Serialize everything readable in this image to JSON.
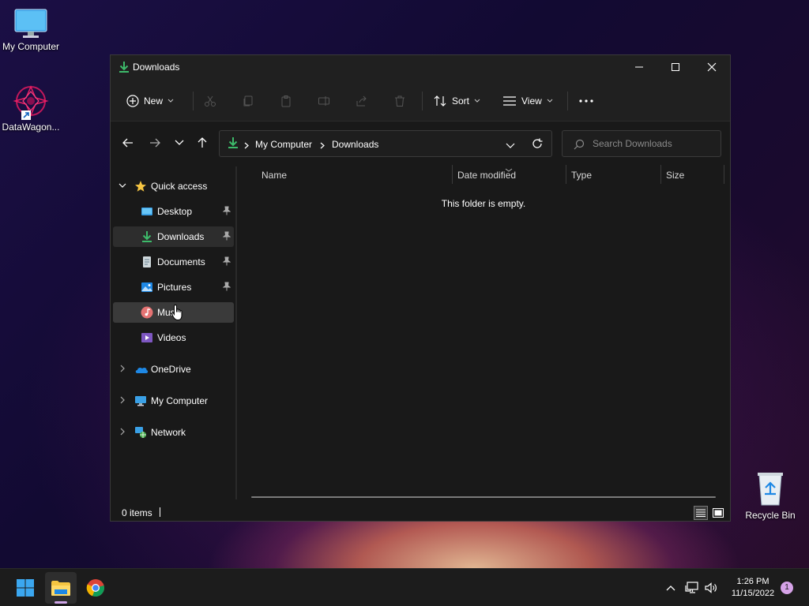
{
  "desktop": {
    "icons": [
      {
        "label": "My Computer"
      },
      {
        "label": "DataWagon..."
      },
      {
        "label": "Recycle Bin"
      }
    ]
  },
  "window": {
    "title": "Downloads",
    "toolbar": {
      "new_label": "New",
      "sort_label": "Sort",
      "view_label": "View"
    },
    "address": {
      "crumbs": [
        "My Computer",
        "Downloads"
      ]
    },
    "search": {
      "placeholder": "Search Downloads"
    },
    "sidebar": {
      "quick_access": "Quick access",
      "items": [
        {
          "label": "Desktop"
        },
        {
          "label": "Downloads"
        },
        {
          "label": "Documents"
        },
        {
          "label": "Pictures"
        },
        {
          "label": "Music"
        },
        {
          "label": "Videos"
        }
      ],
      "sections": [
        {
          "label": "OneDrive"
        },
        {
          "label": "My Computer"
        },
        {
          "label": "Network"
        }
      ]
    },
    "columns": [
      "Name",
      "Date modified",
      "Type",
      "Size"
    ],
    "empty_message": "This folder is empty.",
    "status": {
      "count": "0 items"
    }
  },
  "taskbar": {
    "time": "1:26 PM",
    "date": "11/15/2022",
    "notification_count": "1"
  },
  "colors": {
    "accent": "#4cc2ff",
    "download_green": "#3dba6a",
    "folder_yellow": "#f5c542"
  }
}
